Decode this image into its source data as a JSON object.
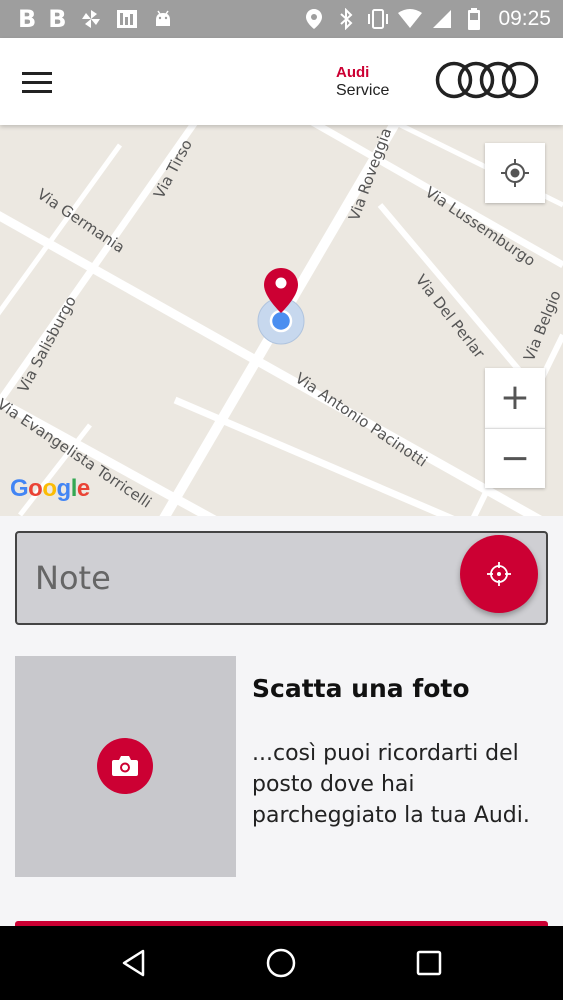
{
  "status_bar": {
    "left_icons": [
      "b-icon",
      "b-icon",
      "pinwheel-icon",
      "chart-icon",
      "android-icon"
    ],
    "right_icons": [
      "location-icon",
      "bluetooth-icon",
      "vibrate-icon",
      "wifi-icon",
      "signal-icon",
      "battery-icon"
    ],
    "left_letters": [
      "B",
      "B"
    ],
    "time": "09:25"
  },
  "app_bar": {
    "brand_top": "Audi",
    "brand_bottom": "Service"
  },
  "map": {
    "streets": {
      "tirso": "Via Tirso",
      "roveggia": "Via Roveggia",
      "lussemburgo": "Via Lussemburgo",
      "germania": "Via Germania",
      "del_perlar": "Via Del Perlar",
      "belgio": "Via Belgio",
      "salisburgo": "Via Salisburgo",
      "pacinotti": "Via Antonio Pacinotti",
      "torricelli": "Via Evangelista Torricelli"
    },
    "zoom_in": "+",
    "zoom_out": "−",
    "google": [
      "G",
      "o",
      "o",
      "g",
      "l",
      "e"
    ]
  },
  "note": {
    "placeholder": "Note"
  },
  "photo": {
    "title": "Scatta una foto",
    "description": "...così puoi ricordarti del posto dove hai parcheggiato la tua Audi."
  },
  "colors": {
    "accent": "#cc0033",
    "status_bar": "#9e9e9e",
    "map_bg": "#ece8e1"
  }
}
